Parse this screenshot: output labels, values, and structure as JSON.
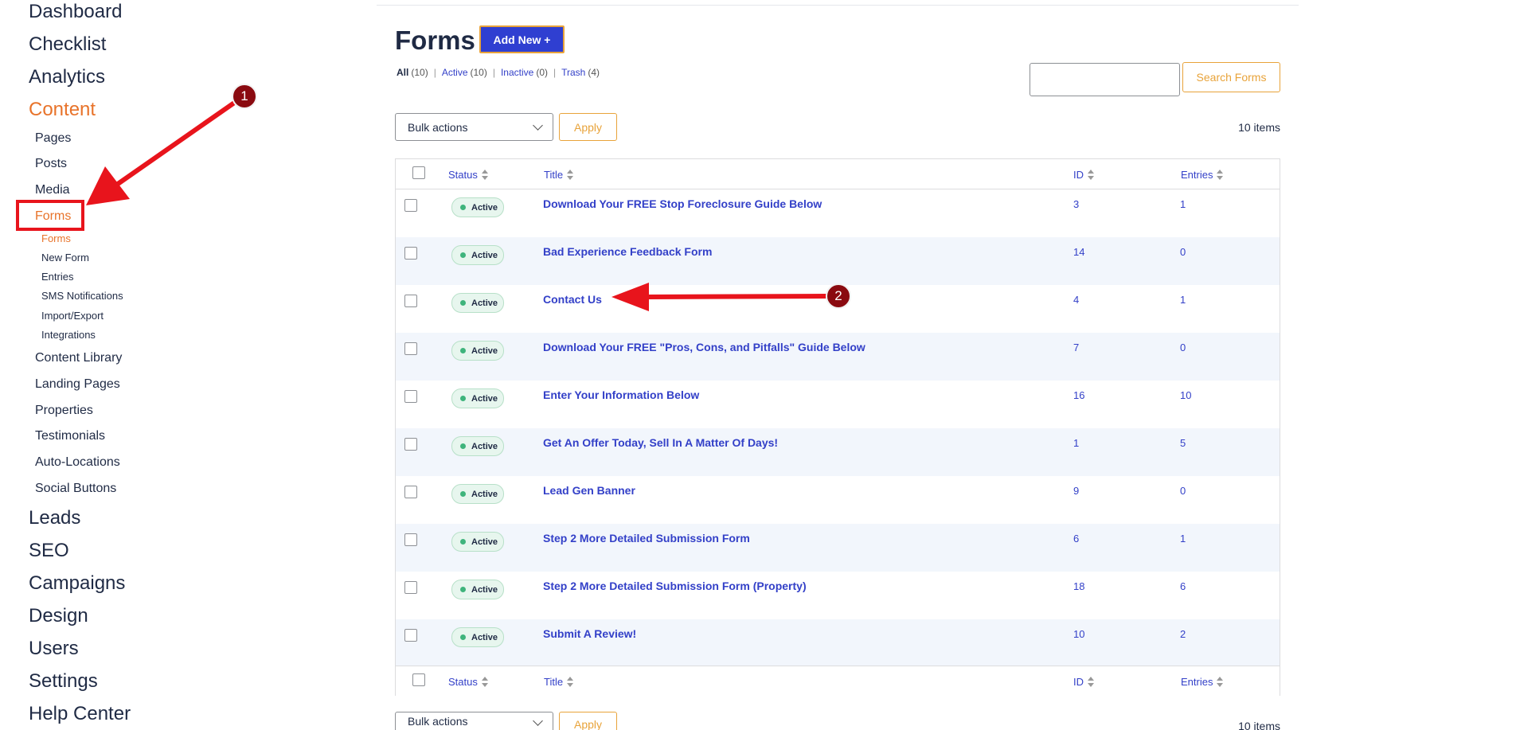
{
  "sidebar": {
    "top_items": [
      {
        "label": "Dashboard"
      },
      {
        "label": "Checklist"
      },
      {
        "label": "Analytics"
      },
      {
        "label": "Content"
      }
    ],
    "content_sub": [
      {
        "label": "Pages"
      },
      {
        "label": "Posts"
      },
      {
        "label": "Media"
      },
      {
        "label": "Forms"
      }
    ],
    "forms_sub": [
      {
        "label": "Forms"
      },
      {
        "label": "New Form"
      },
      {
        "label": "Entries"
      },
      {
        "label": "SMS Notifications"
      },
      {
        "label": "Import/Export"
      },
      {
        "label": "Integrations"
      }
    ],
    "content_sub2": [
      {
        "label": "Content Library"
      },
      {
        "label": "Landing Pages"
      },
      {
        "label": "Properties"
      },
      {
        "label": "Testimonials"
      },
      {
        "label": "Auto-Locations"
      },
      {
        "label": "Social Buttons"
      }
    ],
    "bottom_items": [
      {
        "label": "Leads"
      },
      {
        "label": "SEO"
      },
      {
        "label": "Campaigns"
      },
      {
        "label": "Design"
      },
      {
        "label": "Users"
      },
      {
        "label": "Settings"
      },
      {
        "label": "Help Center"
      }
    ]
  },
  "header": {
    "title": "Forms",
    "add_new_label": "Add New +"
  },
  "filters": [
    {
      "label": "All",
      "count": "(10)"
    },
    {
      "label": "Active",
      "count": "(10)"
    },
    {
      "label": "Inactive",
      "count": "(0)"
    },
    {
      "label": "Trash",
      "count": "(4)"
    }
  ],
  "search": {
    "button_label": "Search Forms",
    "value": ""
  },
  "bulk": {
    "select_value": "Bulk actions",
    "apply_label": "Apply",
    "items_count": "10 items"
  },
  "table": {
    "columns": {
      "status": "Status",
      "title": "Title",
      "id": "ID",
      "entries": "Entries"
    },
    "rows": [
      {
        "status": "Active",
        "title": "Download Your FREE Stop Foreclosure Guide Below",
        "id": "3",
        "entries": "1"
      },
      {
        "status": "Active",
        "title": "Bad Experience Feedback Form",
        "id": "14",
        "entries": "0"
      },
      {
        "status": "Active",
        "title": "Contact Us",
        "id": "4",
        "entries": "1"
      },
      {
        "status": "Active",
        "title": "Download Your FREE \"Pros, Cons, and Pitfalls\" Guide Below",
        "id": "7",
        "entries": "0"
      },
      {
        "status": "Active",
        "title": "Enter Your Information Below",
        "id": "16",
        "entries": "10"
      },
      {
        "status": "Active",
        "title": "Get An Offer Today, Sell In A Matter Of Days!",
        "id": "1",
        "entries": "5"
      },
      {
        "status": "Active",
        "title": "Lead Gen Banner",
        "id": "9",
        "entries": "0"
      },
      {
        "status": "Active",
        "title": "Step 2 More Detailed Submission Form",
        "id": "6",
        "entries": "1"
      },
      {
        "status": "Active",
        "title": "Step 2 More Detailed Submission Form (Property)",
        "id": "18",
        "entries": "6"
      },
      {
        "status": "Active",
        "title": "Submit A Review!",
        "id": "10",
        "entries": "2"
      }
    ]
  },
  "annotations": {
    "marker_1": "1",
    "marker_2": "2",
    "arrow_color": "#e8141c",
    "marker_color": "#8a0a10"
  },
  "colors": {
    "accent": "#e8732a",
    "link": "#3340c8",
    "primary_button": "#2f3fd1",
    "active_badge": "#e7f6ee"
  }
}
